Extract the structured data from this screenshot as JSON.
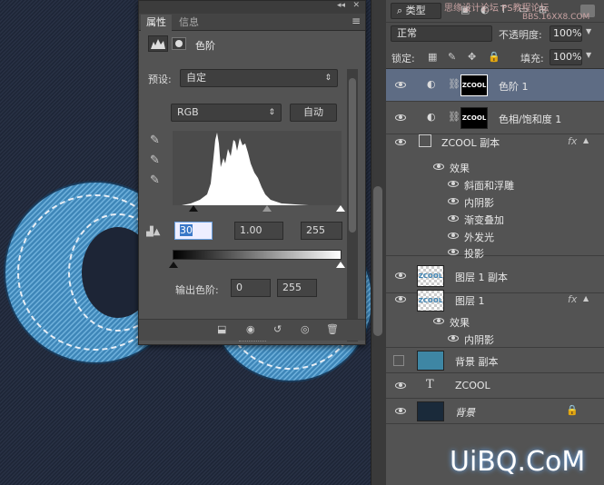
{
  "properties_panel": {
    "tabs": [
      "属性",
      "信息"
    ],
    "adjustment_title": "色阶",
    "preset_label": "预设:",
    "preset_value": "自定",
    "channel_value": "RGB",
    "auto_label": "自动",
    "input_black": "30",
    "input_gamma": "1.00",
    "input_white": "255",
    "output_label": "输出色阶:",
    "output_black": "0",
    "output_white": "255"
  },
  "layers_panel": {
    "filter_kind": "类型",
    "blend_mode": "正常",
    "opacity_label": "不透明度:",
    "opacity_value": "100%",
    "lock_label": "锁定:",
    "fill_label": "填充:",
    "fill_value": "100%",
    "layers": [
      {
        "name": "色阶 1",
        "selected": true
      },
      {
        "name": "色相/饱和度 1"
      },
      {
        "name": "ZCOOL 副本"
      },
      {
        "name": "效果"
      },
      {
        "name": "斜面和浮雕"
      },
      {
        "name": "内阴影"
      },
      {
        "name": "渐变叠加"
      },
      {
        "name": "外发光"
      },
      {
        "name": "投影"
      },
      {
        "name": "图层 1 副本"
      },
      {
        "name": "图层 1"
      },
      {
        "name": "效果"
      },
      {
        "name": "内阴影"
      },
      {
        "name": "背景 副本"
      },
      {
        "name": "ZCOOL"
      },
      {
        "name": "背景"
      }
    ],
    "thumb_text": "ZCOOL"
  },
  "watermarks": {
    "top_right": "思缘设计论坛   PS教程论坛",
    "top_right_url": "BBS.16XX8.COM",
    "bottom_right": "UiBQ.CoM"
  },
  "colors": {
    "accent": "#5e6c84",
    "panel": "#535353",
    "canvas": "#1d2536"
  }
}
